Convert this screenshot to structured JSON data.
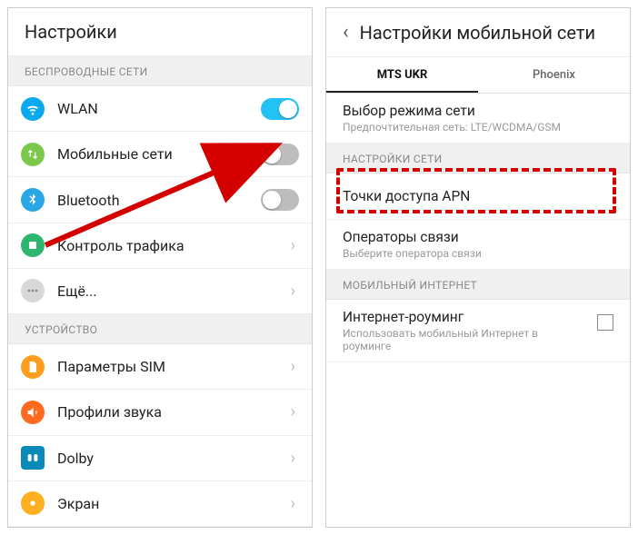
{
  "left": {
    "title": "Настройки",
    "sections": {
      "wireless_header": "БЕСПРОВОДНЫЕ СЕТИ",
      "device_header": "УСТРОЙСТВО"
    },
    "items": {
      "wlan": "WLAN",
      "mobile": "Мобильные сети",
      "bluetooth": "Bluetooth",
      "traffic": "Контроль трафика",
      "more": "Ещё...",
      "sim": "Параметры SIM",
      "sound": "Профили звука",
      "dolby": "Dolby",
      "display": "Экран"
    }
  },
  "right": {
    "title": "Настройки мобильной сети",
    "tabs": {
      "a": "MTS UKR",
      "b": "Phoenix"
    },
    "network_mode": {
      "title": "Выбор режима сети",
      "sub": "Предпочтительная сеть: LTE/WCDMA/GSM"
    },
    "net_settings_header": "НАСТРОЙКИ СЕТИ",
    "apn": {
      "title": "Точки доступа APN"
    },
    "operators": {
      "title": "Операторы связи",
      "sub": "Выберите оператора связи"
    },
    "mobile_internet_header": "МОБИЛЬНЫЙ ИНТЕРНЕТ",
    "roaming": {
      "title": "Интернет-роуминг",
      "sub": "Использовать мобильный Интернет в роуминге"
    }
  }
}
